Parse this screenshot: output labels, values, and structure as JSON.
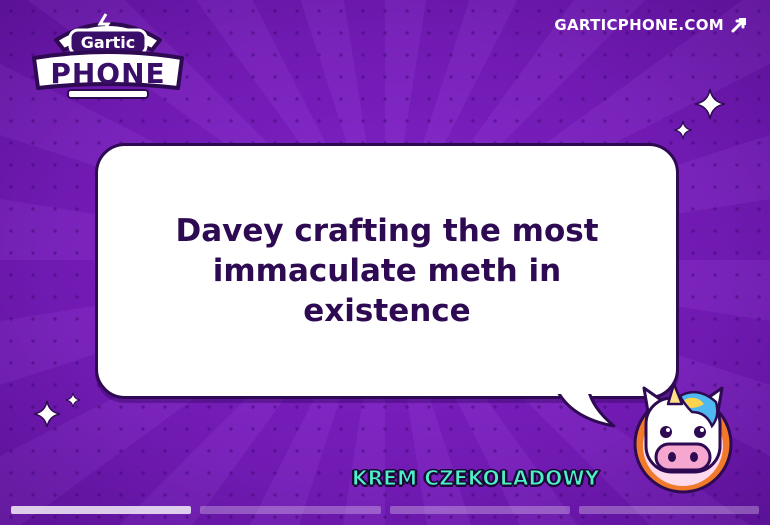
{
  "logo": {
    "top_text": "Gartic",
    "main_text": "PHONE"
  },
  "header": {
    "site_url": "GARTICPHONE.COM",
    "link_icon": "pencil-arrow-icon"
  },
  "bubble": {
    "text": "Davey crafting the most immaculate meth in existence"
  },
  "player": {
    "name": "KREM CZEKOLADOWY",
    "avatar_icon": "unicorn-avatar-icon"
  },
  "progress": {
    "segments_total": 4,
    "active_segment": 1
  },
  "colors": {
    "background": "#7a1fbf",
    "bubble_text": "#2d0a52",
    "player_name": "#4ef0c8",
    "avatar_ring": "#f07a2a"
  }
}
